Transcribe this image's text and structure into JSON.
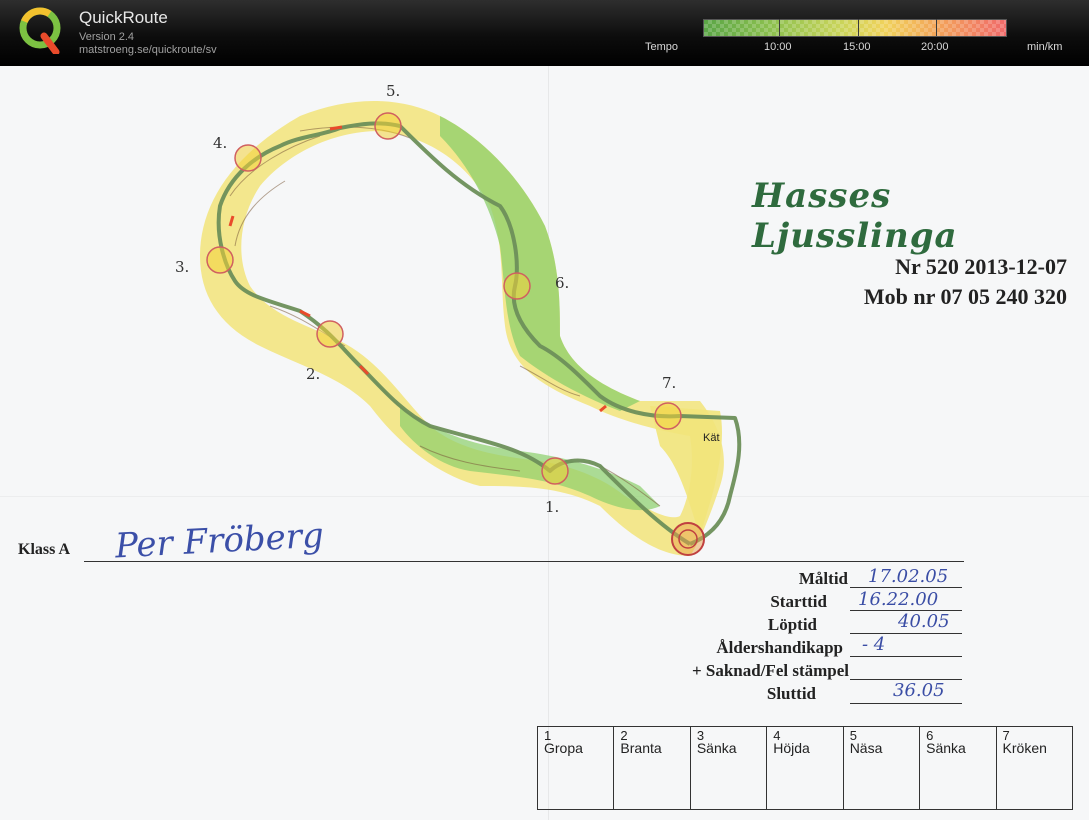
{
  "app": {
    "title": "QuickRoute",
    "version": "Version 2.4",
    "url": "matstroeng.se/quickroute/sv"
  },
  "tempo": {
    "label": "Tempo",
    "ticks": [
      "10:00",
      "15:00",
      "20:00"
    ],
    "unit": "min/km"
  },
  "map": {
    "title": "Hasses Ljusslinga",
    "nr_line": "Nr 520 2013-12-07",
    "mob_line": "Mob nr 07  05 240 320",
    "control_numbers": [
      "1.",
      "2.",
      "3.",
      "4.",
      "5.",
      "6.",
      "7."
    ],
    "terrain_label": "Kät",
    "klass_label": "Klass A",
    "runner_name": "Per Fröberg"
  },
  "results": {
    "maltid_label": "Måltid",
    "maltid_value": "17.02.05",
    "starttid_label": "Starttid",
    "starttid_value": "16.22.00",
    "loptid_label": "Löptid",
    "loptid_value": "40.05",
    "handikapp_label": "Åldershandikapp",
    "handikapp_value": "- 4",
    "saknad_label": "+ Saknad/Fel stämpel",
    "sluttid_label": "Sluttid",
    "sluttid_value": "36.05"
  },
  "controls": [
    {
      "num": "1",
      "name": "Gropa"
    },
    {
      "num": "2",
      "name": "Branta"
    },
    {
      "num": "3",
      "name": "Sänka"
    },
    {
      "num": "4",
      "name": "Höjda"
    },
    {
      "num": "5",
      "name": "Näsa"
    },
    {
      "num": "6",
      "name": "Sänka"
    },
    {
      "num": "7",
      "name": "Kröken"
    }
  ],
  "colors": {
    "route": "#6d8f5a",
    "forest_green": "#8ccf6b",
    "open_yellow": "#f2e47a",
    "title_green": "#2f6b3e",
    "ink_blue": "#3a4da5"
  }
}
